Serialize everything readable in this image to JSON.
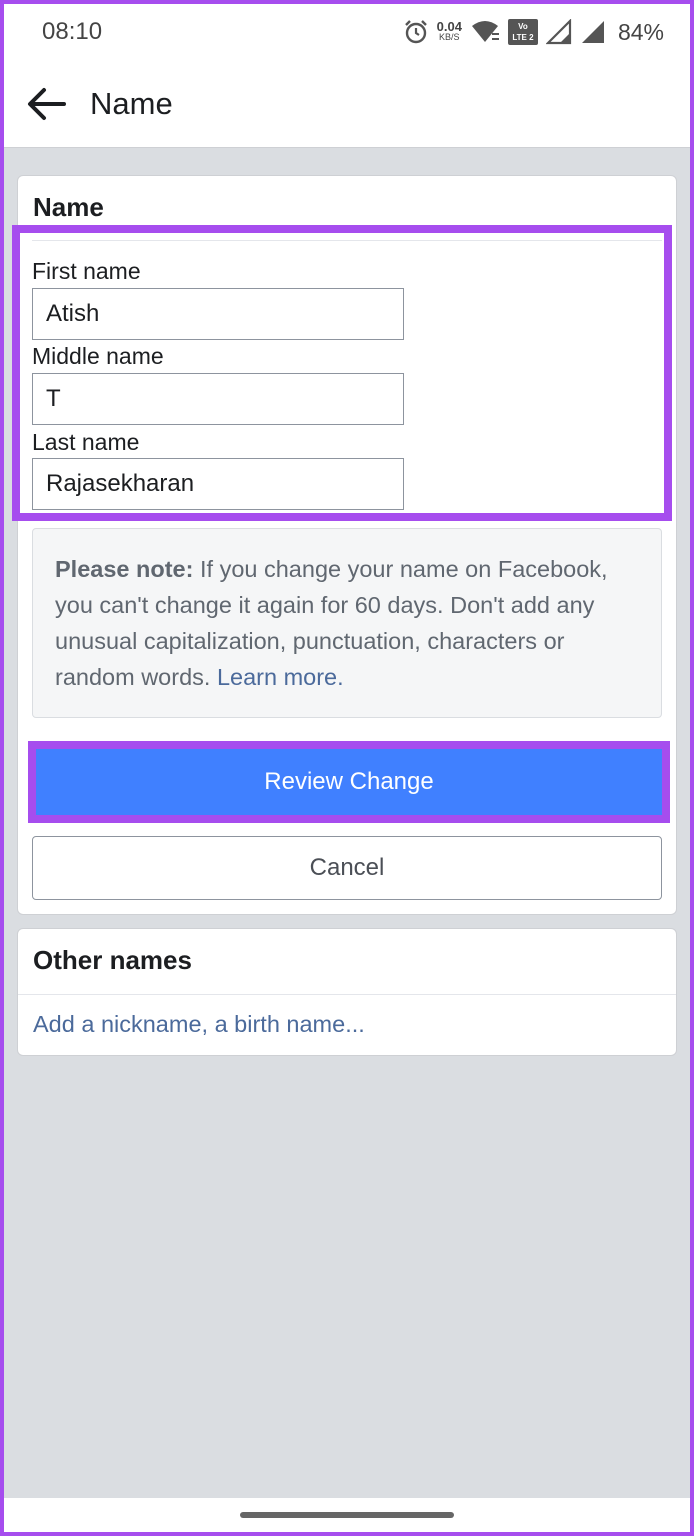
{
  "status_bar": {
    "time": "08:10",
    "net_speed_value": "0.04",
    "net_speed_unit": "KB/S",
    "volte_top": "Vo",
    "volte_bottom": "LTE 2",
    "battery": "84%"
  },
  "appbar": {
    "title": "Name"
  },
  "name_card": {
    "heading": "Name",
    "fields": [
      {
        "label": "First name",
        "value": "Atish"
      },
      {
        "label": "Middle name",
        "value": "T"
      },
      {
        "label": "Last name",
        "value": "Rajasekharan"
      }
    ],
    "note": {
      "bold": "Please note:",
      "text": " If you change your name on Facebook, you can't change it again for 60 days. Don't add any unusual capitalization, punctuation, characters or random words. ",
      "link": "Learn more",
      "end": "."
    },
    "review_label": "Review Change",
    "cancel_label": "Cancel"
  },
  "other_names": {
    "heading": "Other names",
    "link": "Add a nickname, a birth name..."
  },
  "colors": {
    "highlight": "#a64dee",
    "primary_button": "#4080ff",
    "link": "#4b6a9b"
  },
  "icons": [
    "alarm-icon",
    "wifi-icon",
    "signal-icon",
    "back-arrow-icon"
  ]
}
